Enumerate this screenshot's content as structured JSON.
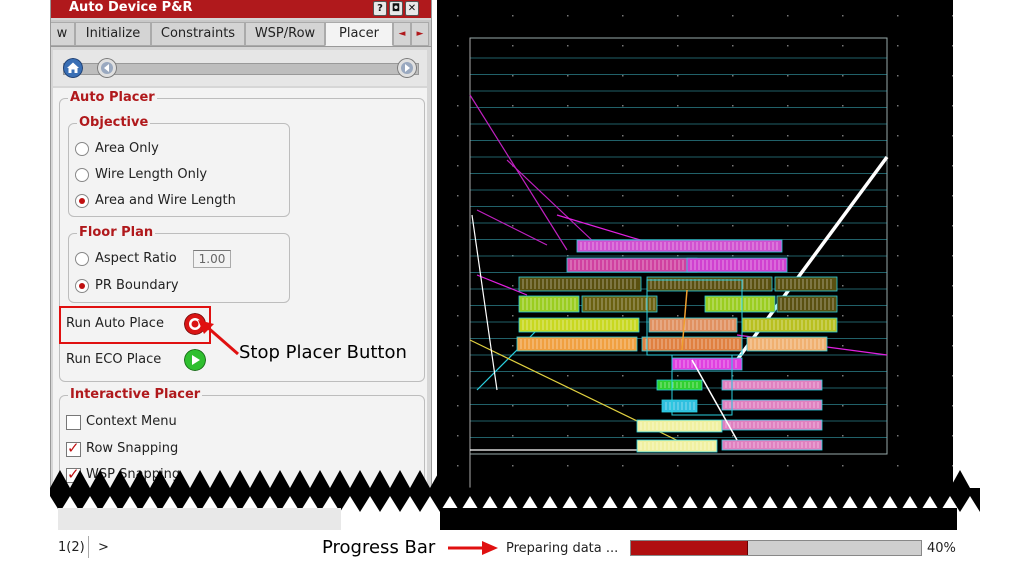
{
  "window": {
    "title": "Auto Device P&R",
    "title_buttons": [
      "?",
      "◘",
      "✕"
    ]
  },
  "tabs": {
    "partial_left": "w",
    "items": [
      "Initialize",
      "Constraints",
      "WSP/Row",
      "Placer"
    ],
    "active": "Placer",
    "scroll": [
      "◄",
      "►"
    ]
  },
  "auto_placer": {
    "title": "Auto Placer",
    "objective": {
      "title": "Objective",
      "options": [
        "Area Only",
        "Wire Length Only",
        "Area and Wire Length"
      ],
      "selected": "Area and Wire Length"
    },
    "floor_plan": {
      "title": "Floor Plan",
      "aspect_ratio_label": "Aspect Ratio",
      "aspect_ratio_value": "1.00",
      "pr_boundary_label": "PR Boundary",
      "selected": "PR Boundary"
    },
    "run_auto_place_label": "Run Auto Place",
    "run_eco_place_label": "Run ECO Place"
  },
  "interactive_placer": {
    "title": "Interactive Placer",
    "context_menu_label": "Context Menu",
    "context_menu_checked": false,
    "row_snapping_label": "Row Snapping",
    "row_snapping_checked": true,
    "wsp_snapping_label": "WSP Snapping",
    "wsp_snapping_checked": true
  },
  "annotations": {
    "stop_placer": "Stop Placer Button",
    "progress_bar": "Progress Bar"
  },
  "statusbar": {
    "page": "1(2)",
    "prompt": ">",
    "message": "Preparing data ...",
    "progress_percent": 40,
    "progress_text": "40%"
  },
  "colors": {
    "accent_red": "#b0191c",
    "progress_fill": "#b00f10",
    "canvas_bg": "#000000",
    "row_line": "#3fb9c9"
  }
}
